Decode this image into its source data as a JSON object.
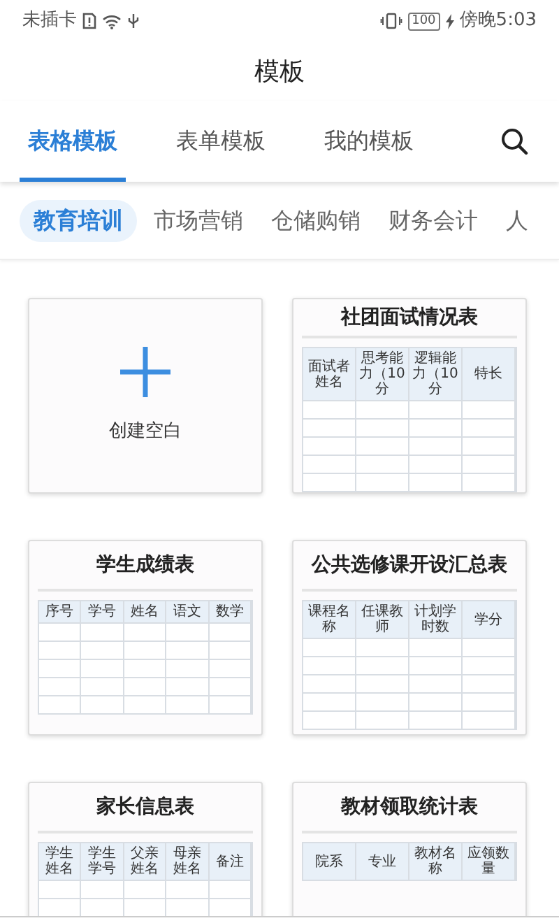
{
  "status_bar": {
    "carrier": "未插卡",
    "battery": "100",
    "time": "傍晚5:03"
  },
  "title": "模板",
  "tabs": [
    {
      "label": "表格模板",
      "selected": true
    },
    {
      "label": "表单模板",
      "selected": false
    },
    {
      "label": "我的模板",
      "selected": false
    }
  ],
  "categories": [
    {
      "label": "教育培训",
      "selected": true
    },
    {
      "label": "市场营销",
      "selected": false
    },
    {
      "label": "仓储购销",
      "selected": false
    },
    {
      "label": "财务会计",
      "selected": false
    },
    {
      "label": "人",
      "selected": false
    }
  ],
  "template_rows": [
    [
      {
        "kind": "blank",
        "label": "创建空白"
      },
      {
        "kind": "table",
        "title": "社团面试情况表",
        "columns": [
          "面试者姓名",
          "思考能力（10分",
          "逻辑能力（10分",
          "特长"
        ]
      }
    ],
    [
      {
        "kind": "table",
        "title": "学生成绩表",
        "columns": [
          "序号",
          "学号",
          "姓名",
          "语文",
          "数学"
        ]
      },
      {
        "kind": "table",
        "title": "公共选修课开设汇总表",
        "columns": [
          "课程名称",
          "任课教师",
          "计划学时数",
          "学分"
        ]
      }
    ],
    [
      {
        "kind": "table",
        "title": "家长信息表",
        "columns": [
          "学生姓名",
          "学生学号",
          "父亲姓名",
          "母亲姓名",
          "备注"
        ]
      },
      {
        "kind": "table",
        "title": "教材领取统计表",
        "columns": [
          "院系",
          "专业",
          "教材名称",
          "应领数量"
        ]
      }
    ]
  ]
}
